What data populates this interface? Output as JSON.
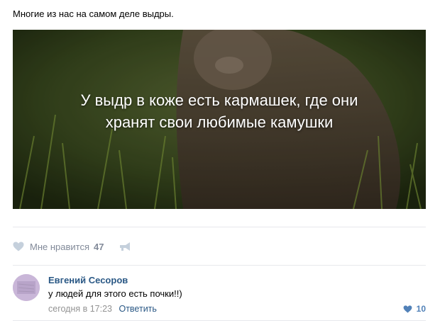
{
  "post": {
    "text": "Многие из нас на самом деле выдры.",
    "image_caption_line1": "У выдр в коже есть кармашек, где они",
    "image_caption_line2": "хранят свои любимые камушки"
  },
  "actions": {
    "like_label": "Мне нравится",
    "like_count": "47",
    "icons": [
      "heart-icon",
      "share-icon"
    ]
  },
  "comment": {
    "author": "Евгений Сесоров",
    "text": "у людей для этого есть почки!!)",
    "time": "сегодня в 17:23",
    "reply_label": "Ответить",
    "like_count": "10"
  },
  "colors": {
    "link": "#2a5885",
    "muted": "#828a99",
    "like_blue": "#5181b8",
    "divider": "#e7e8ec"
  }
}
